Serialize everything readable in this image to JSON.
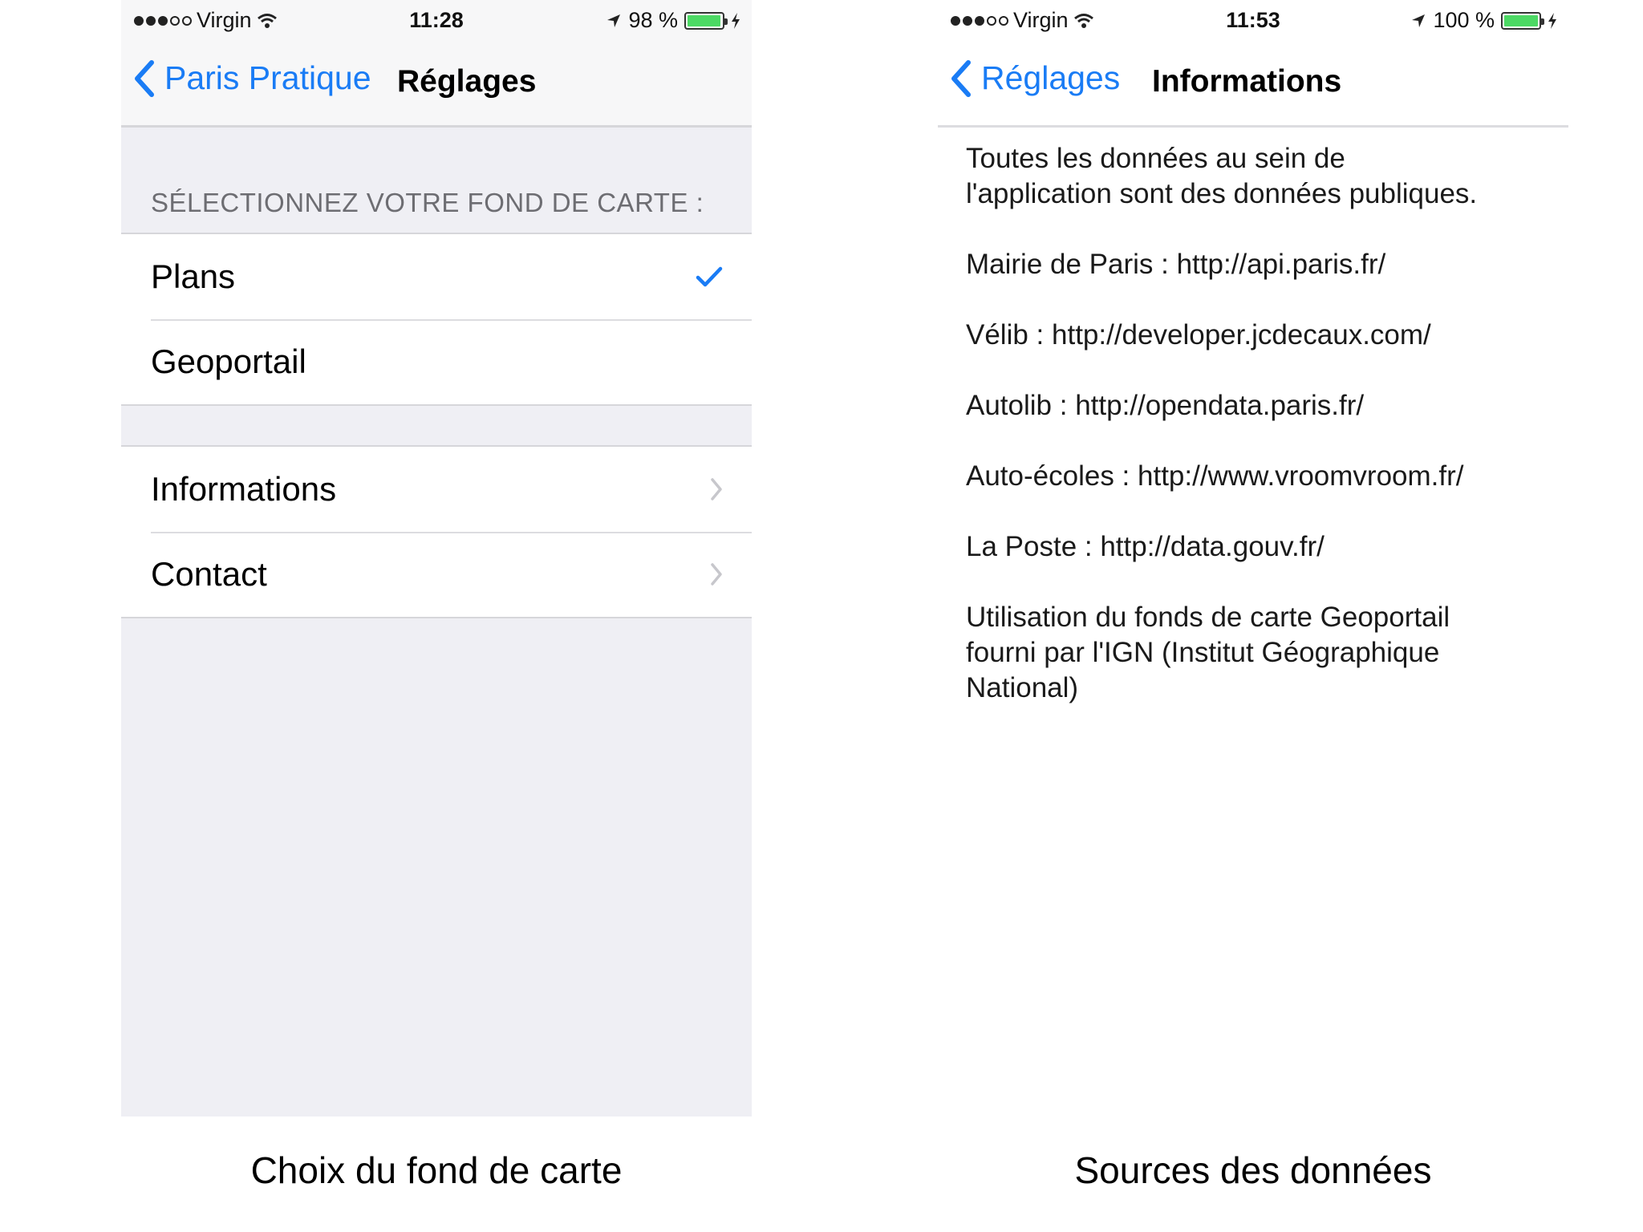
{
  "left_screen": {
    "status": {
      "carrier": "Virgin",
      "time": "11:28",
      "battery": "98 %",
      "battery_level": 0.98
    },
    "nav": {
      "back_label": "Paris Pratique",
      "title": "Réglages"
    },
    "section_header": "SÉLECTIONNEZ VOTRE FOND DE CARTE :",
    "map_options": [
      {
        "label": "Plans",
        "selected": true
      },
      {
        "label": "Geoportail",
        "selected": false
      }
    ],
    "links": [
      {
        "label": "Informations"
      },
      {
        "label": "Contact"
      }
    ]
  },
  "right_screen": {
    "status": {
      "carrier": "Virgin",
      "time": "11:53",
      "battery": "100 %",
      "battery_level": 1.0
    },
    "nav": {
      "back_label": "Réglages",
      "title": "Informations"
    },
    "paragraphs": {
      "intro_1": "Toutes les données au sein de",
      "intro_2": "l'application sont des données publiques.",
      "mairie": "Mairie de Paris : http://api.paris.fr/",
      "velib": "Vélib : http://developer.jcdecaux.com/",
      "autolib": "Autolib : http://opendata.paris.fr/",
      "auto_ecoles": "Auto-écoles : http://www.vroomvroom.fr/",
      "la_poste": "La Poste : http://data.gouv.fr/",
      "geoportail_1": "Utilisation du fonds de carte Geoportail",
      "geoportail_2": "fourni par l'IGN (Institut Géographique",
      "geoportail_3": "National)"
    }
  },
  "captions": {
    "left": "Choix du fond de carte",
    "right": "Sources des données"
  },
  "colors": {
    "accent": "#1a7cf5",
    "grouped_background": "#efeff4",
    "battery_green": "#4cd964"
  },
  "icons": {
    "back": "chevron-left-icon",
    "checkmark": "checkmark-icon",
    "disclosure": "chevron-right-icon",
    "wifi": "wifi-icon",
    "location": "location-arrow-icon",
    "charging": "bolt-icon"
  }
}
